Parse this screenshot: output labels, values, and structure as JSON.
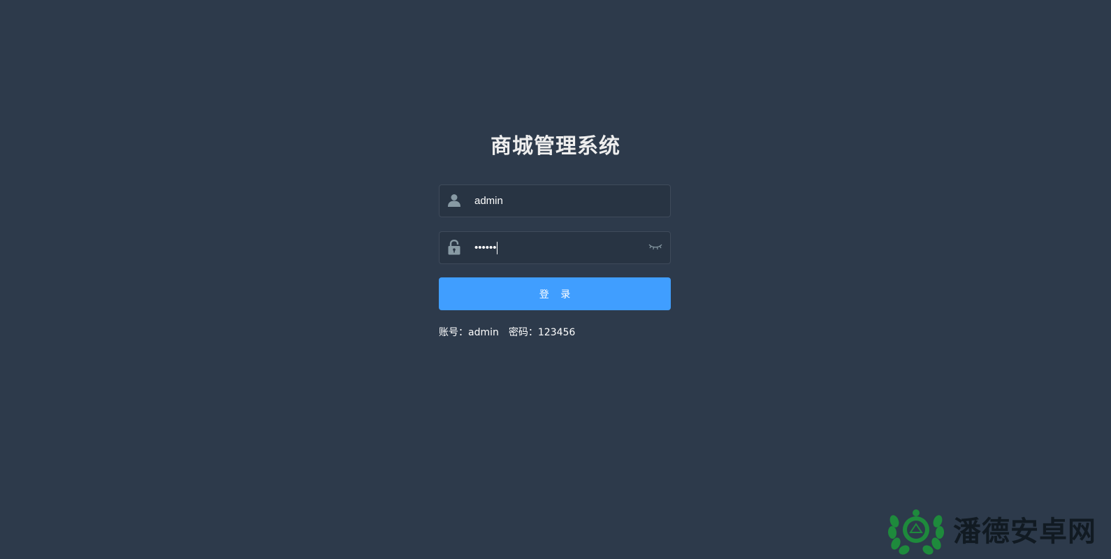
{
  "login": {
    "title": "商城管理系统",
    "username": {
      "value": "admin",
      "placeholder": "",
      "icon": "user-icon"
    },
    "password": {
      "value": "123456",
      "placeholder": "",
      "icon": "lock-icon",
      "toggle_icon": "eye-closed-icon"
    },
    "submit_label": "登 录",
    "tips": {
      "account_label": "账号：",
      "account_value": "admin",
      "password_label": "密码：",
      "password_value": "123456"
    }
  },
  "watermark": {
    "text": "潘德安卓网",
    "logo": "wreath-logo"
  },
  "colors": {
    "background": "#2d3a4b",
    "input_background": "#283443",
    "input_border": "#3f4b5b",
    "primary": "#409eff",
    "icon": "#889aa4",
    "watermark_green": "#1e8a3c"
  }
}
